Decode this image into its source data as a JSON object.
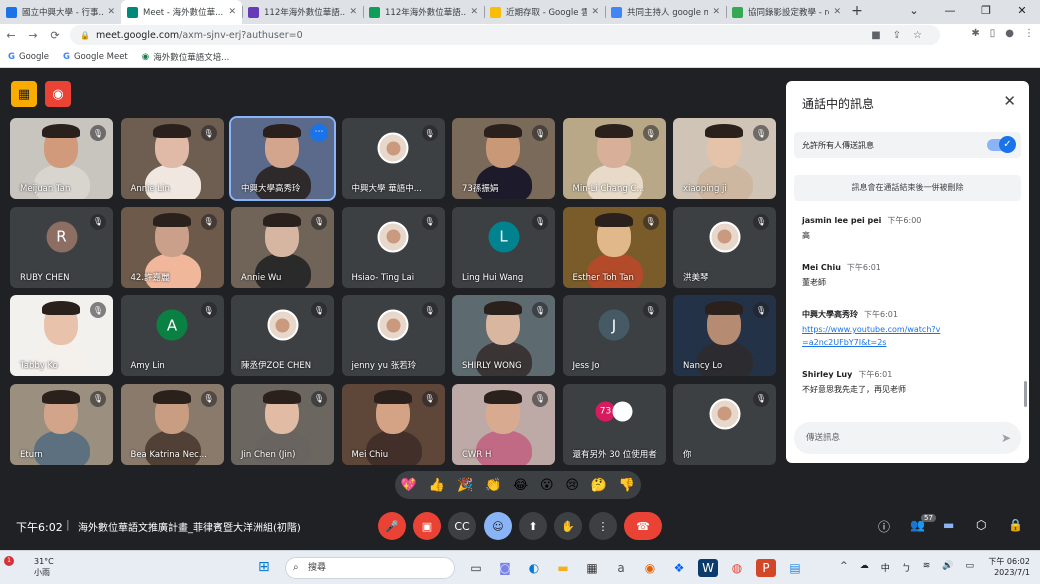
{
  "browser": {
    "tabs": [
      {
        "title": "國立中興大學 - 行事...",
        "color": "#1a73e8"
      },
      {
        "title": "Meet - 海外數位華...",
        "color": "#00897b",
        "active": true
      },
      {
        "title": "112年海外數位華語...",
        "color": "#673ab7"
      },
      {
        "title": "112年海外數位華語...",
        "color": "#0f9d58"
      },
      {
        "title": "近期存取 - Google 雲...",
        "color": "#fbbc04"
      },
      {
        "title": "共同主持人 google m...",
        "color": "#4285f4"
      },
      {
        "title": "協同錄影設定教學 - reu...",
        "color": "#34a853"
      }
    ],
    "url_host": "meet.google.com",
    "url_path": "/axm-sjnv-erj?authuser=0",
    "bookmarks": [
      "Google",
      "Google Meet",
      "海外數位華語文培..."
    ]
  },
  "tiles": [
    {
      "name": "Meijuan Tan",
      "bg": "#c8c4be",
      "skin": "#d19a7a",
      "shirt": "#d8d5cf"
    },
    {
      "name": "Annie Lin",
      "bg": "#6e5e52",
      "skin": "#e0b9a7",
      "shirt": "#efe7e0"
    },
    {
      "name": "中興大學高秀玲",
      "bg": "#5b6a8a",
      "skin": "#d3a58c",
      "shirt": "#2e2a2c",
      "selected": true
    },
    {
      "name": "中興大學 華語中...",
      "bg": "#3c4043",
      "avatar_img": true
    },
    {
      "name": "73孫振娟",
      "bg": "#7a6a5a",
      "skin": "#c99877",
      "shirt": "#1d1b2b"
    },
    {
      "name": "Min-Li Chang C...",
      "bg": "#b8a888",
      "skin": "#d8b09a",
      "shirt": "#e8dac8"
    },
    {
      "name": "xiaoping ji",
      "bg": "#cfc4b6",
      "skin": "#e5c2aa",
      "shirt": "#cdb7a0"
    },
    {
      "name": "RUBY CHEN",
      "bg": "#3c4043",
      "letter": "R",
      "letter_color": "#8d6e63"
    },
    {
      "name": "42.許嘉麗",
      "bg": "#6d5a4b",
      "skin": "#caa08a",
      "shirt": "#f0b79b"
    },
    {
      "name": "Annie Wu",
      "bg": "#706358",
      "skin": "#d6b6a1",
      "shirt": "#2b2a2a"
    },
    {
      "name": "Hsiao- Ting Lai",
      "bg": "#3c4043",
      "avatar_img": true
    },
    {
      "name": "Ling Hui Wang",
      "bg": "#3c4043",
      "letter": "L",
      "letter_color": "#00838f"
    },
    {
      "name": "Esther Toh Tan",
      "bg": "#7a5c2a",
      "skin": "#e0b889",
      "shirt": "#b34a2a"
    },
    {
      "name": "洪美琴",
      "bg": "#3c4043",
      "avatar_img": true
    },
    {
      "name": "Tabby Ko",
      "bg": "#f3f1ee",
      "skin": "#e8c2aa",
      "shirt": "#f4f1ed"
    },
    {
      "name": "Amy Lin",
      "bg": "#3c4043",
      "letter": "A",
      "letter_color": "#0b8043"
    },
    {
      "name": "陳丞伊ZOE CHEN",
      "bg": "#3c4043",
      "avatar_img": true
    },
    {
      "name": "jenny yu 张若玲",
      "bg": "#3c4043",
      "avatar_img": true
    },
    {
      "name": "SHIRLY WONG",
      "bg": "#5d6a6f",
      "skin": "#d9b6a0",
      "shirt": "#3a3434"
    },
    {
      "name": "Jess Jo",
      "bg": "#3c4043",
      "letter": "J",
      "letter_color": "#455a64"
    },
    {
      "name": "Nancy Lo",
      "bg": "#243247",
      "skin": "#b58b72",
      "shirt": "#2c2b2f"
    },
    {
      "name": "Eturn",
      "bg": "#9b8f7f",
      "skin": "#d2a58a",
      "shirt": "#5c7080"
    },
    {
      "name": "Bea Katrina Nec...",
      "bg": "#8a7a6c",
      "skin": "#c89d82",
      "shirt": "#514035"
    },
    {
      "name": "Jin Chen (Jin)",
      "bg": "#6b6660",
      "skin": "#e1bba3",
      "shirt": "#6a6460"
    },
    {
      "name": "Mei Chiu",
      "bg": "#5e4638",
      "skin": "#d4a386",
      "shirt": "#432f2a"
    },
    {
      "name": "CWR H",
      "bg": "#bda9a5",
      "skin": "#d8aa90",
      "shirt": "#c06a86"
    },
    {
      "name": "還有另外 30 位使用者",
      "bg": "#3c4043",
      "others": true,
      "others_count": "73"
    },
    {
      "name": "你",
      "bg": "#3c4043",
      "avatar_img": true
    }
  ],
  "chat": {
    "title": "通話中的訊息",
    "allow_label": "允許所有人傳送訊息",
    "pinned_note": "訊息會在通話結束後一併被刪除",
    "messages": [
      {
        "who": "jasmin lee pei pei",
        "time": "下午6:00",
        "text": "高",
        "link": ""
      },
      {
        "who": "Mei Chiu",
        "time": "下午6:01",
        "text": "董老師",
        "link": ""
      },
      {
        "who": "中興大學高秀玲",
        "time": "下午6:01",
        "text": "",
        "link": "https://www.youtube.com/watch?v=a2nc2UFbY7I&t=2s"
      },
      {
        "who": "Shirley Luy",
        "time": "下午6:01",
        "text": "不好意思我先走了，再见老师",
        "link": ""
      }
    ],
    "input_placeholder": "傳送訊息"
  },
  "reactions": [
    "💖",
    "👍",
    "🎉",
    "👏",
    "😂",
    "😮",
    "😢",
    "🤔",
    "👎"
  ],
  "bottom": {
    "clock": "下午6:02",
    "meeting_name": "海外數位華語文推廣計畫_菲律賓暨大洋洲組(初階)",
    "people_count": "57"
  },
  "taskbar": {
    "temp": "31°C",
    "weather": "小雨",
    "search_placeholder": "搜尋",
    "ime": "中",
    "time": "下午 06:02",
    "date": "2023/7/1",
    "notif": "1"
  }
}
